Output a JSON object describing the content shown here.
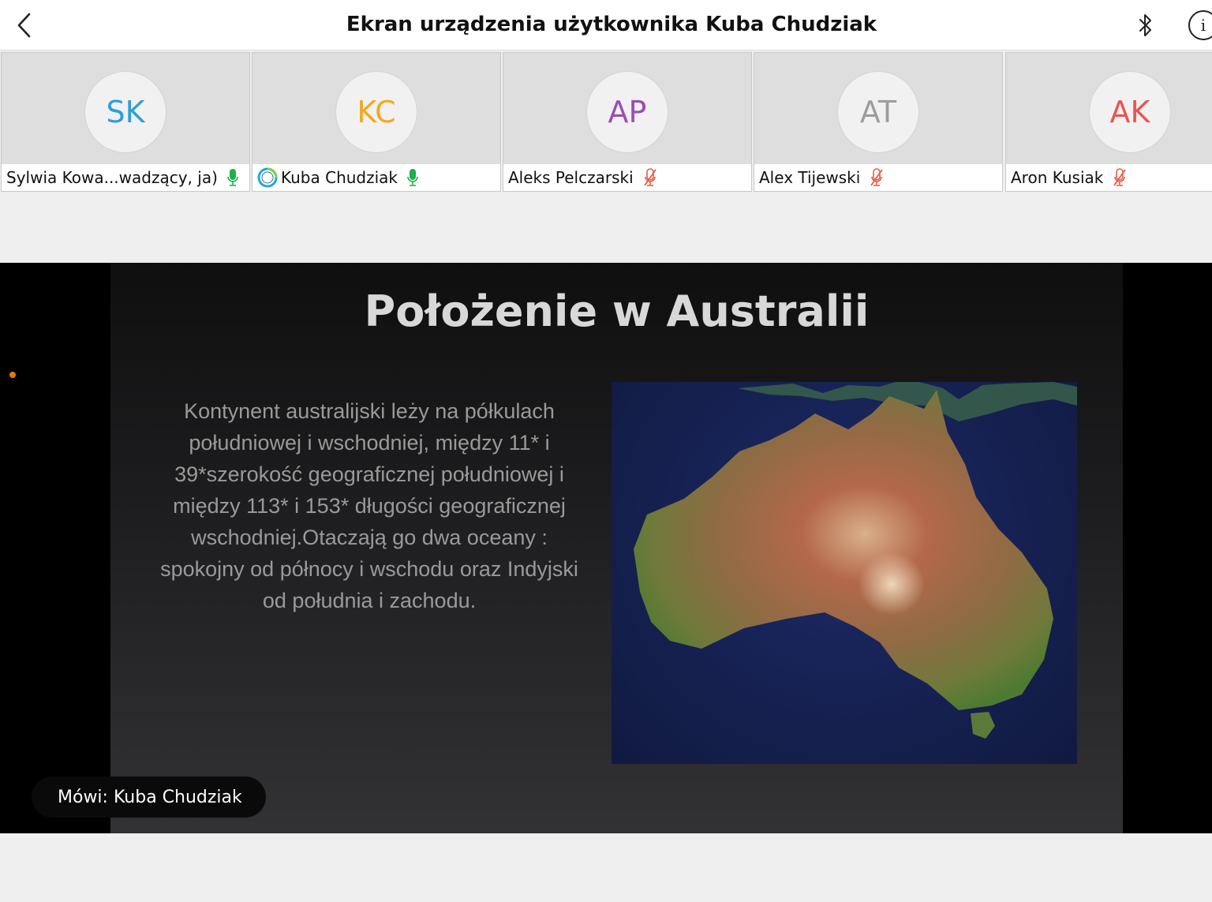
{
  "header": {
    "title": "Ekran urządzenia użytkownika Kuba Chudziak"
  },
  "participants": [
    {
      "initials": "SK",
      "name": "Sylwia Kowa...wadzący, ja)",
      "color": "#2f9ed8",
      "mic": "on"
    },
    {
      "initials": "KC",
      "name": "Kuba Chudziak",
      "color": "#f4a821",
      "mic": "on",
      "sharing": true
    },
    {
      "initials": "AP",
      "name": "Aleks Pelczarski",
      "color": "#9a4fb5",
      "mic": "muted"
    },
    {
      "initials": "AT",
      "name": "Alex Tijewski",
      "color": "#9d9d9d",
      "mic": "muted"
    },
    {
      "initials": "AK",
      "name": "Aron Kusiak",
      "color": "#ec5353",
      "mic": "muted"
    }
  ],
  "share": {
    "slide_title": "Położenie w Australii",
    "slide_body": "Kontynent australijski leży na półkulach południowej i wschodniej, między 11* i 39*szerokość geograficznej południowej i między 113* i 153* długości geograficznej wschodniej.Otaczają go dwa oceany : spokojny od północy i wschodu oraz Indyjski od południa i zachodu.",
    "speaker_label": "Mówi: Kuba Chudziak"
  },
  "colors": {
    "mic_on": "#1fae4b",
    "mic_muted": "#ea5b45",
    "accent_pointer": "#e07a10"
  }
}
